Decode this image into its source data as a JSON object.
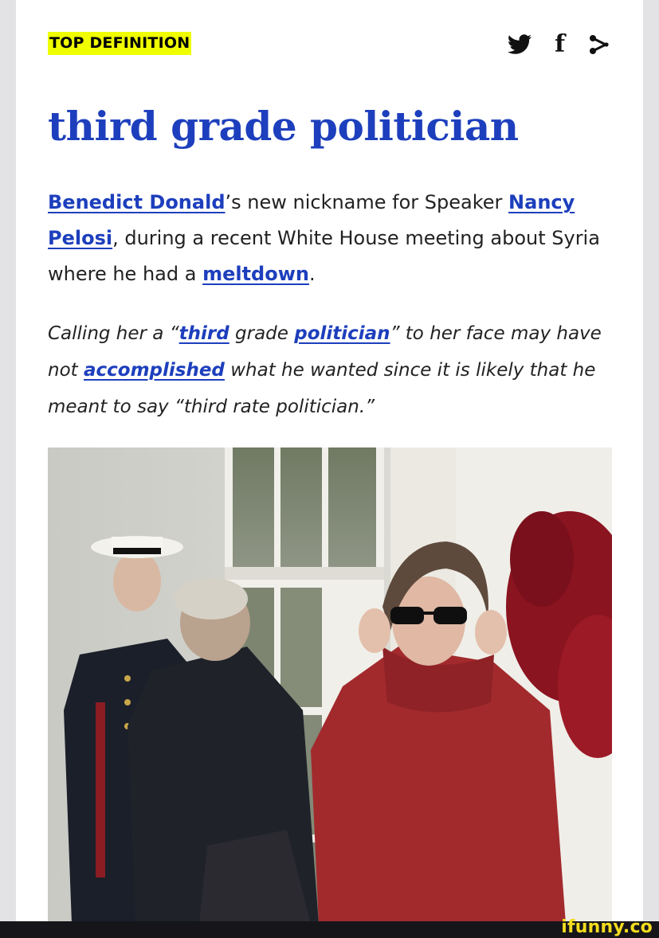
{
  "header": {
    "badge": "TOP DEFINITION",
    "share_icons": [
      "twitter-icon",
      "facebook-icon",
      "share-icon"
    ],
    "facebook_glyph": "f"
  },
  "entry": {
    "word": "third grade politician",
    "meaning": {
      "link1": "Benedict Donald",
      "text1": "’s new nickname for Speaker ",
      "link2": "Nancy Pelosi",
      "text2": ", during a recent White House meeting about Syria where he had a ",
      "link3": "meltdown",
      "text3": "."
    },
    "example": {
      "text1": "Calling her a “",
      "link1": "third",
      "text2": " grade ",
      "link2": "politician",
      "text3": "” to her face may have not ",
      "link3": "accomplished",
      "text4": " what he wanted since it is likely that he meant to say “third rate politician.”"
    }
  },
  "image": {
    "description": "photo of people walking outside White House doors"
  },
  "watermark": "ifunny.co",
  "colors": {
    "link": "#1d3fbd",
    "badge_bg": "#efff00",
    "watermark": "#f3dc1e"
  }
}
